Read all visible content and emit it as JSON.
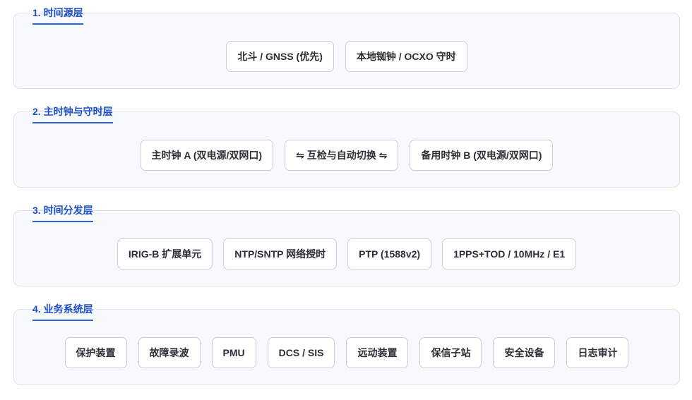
{
  "layers": [
    {
      "title": "1. 时间源层",
      "nodes": [
        "北斗 / GNSS (优先)",
        "本地铷钟 / OCXO 守时"
      ]
    },
    {
      "title": "2. 主时钟与守时层",
      "nodes": [
        "主时钟 A (双电源/双网口)",
        "⇋ 互检与自动切换 ⇋",
        "备用时钟 B (双电源/双网口)"
      ]
    },
    {
      "title": "3. 时间分发层",
      "nodes": [
        "IRIG-B 扩展单元",
        "NTP/SNTP 网络授时",
        "PTP (1588v2)",
        "1PPS+TOD / 10MHz / E1"
      ]
    },
    {
      "title": "4. 业务系统层",
      "nodes": [
        "保护装置",
        "故障录波",
        "PMU",
        "DCS / SIS",
        "远动装置",
        "保信子站",
        "安全设备",
        "日志审计"
      ]
    }
  ]
}
